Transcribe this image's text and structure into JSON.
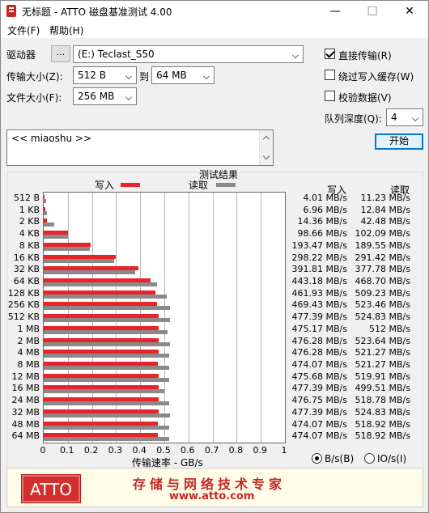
{
  "window": {
    "title": "无标题 - ATTO 磁盘基准测试 4.00",
    "minimize": "—",
    "maximize": "☐",
    "close": "✕"
  },
  "menu": {
    "file": "文件(F)",
    "help": "帮助(H)"
  },
  "drive": {
    "label": "驱动器",
    "browse": "...",
    "value": "(E:) Teclast_S50"
  },
  "transfer_size": {
    "label": "传输大小(Z):",
    "from": "512 B",
    "to_label": "到",
    "to": "64 MB"
  },
  "file_size": {
    "label": "文件大小(F):",
    "value": "256 MB"
  },
  "options": {
    "direct_io": {
      "label": "直接传输(R)",
      "checked": true
    },
    "bypass_cache": {
      "label": "绕过写入缓存(W)",
      "checked": false
    },
    "verify": {
      "label": "校验数据(V)",
      "checked": false
    },
    "queue_depth_label": "队列深度(Q):",
    "queue_depth": "4"
  },
  "description": "<< miaoshu >>",
  "start_button": "开始",
  "results": {
    "group_title": "测试结果",
    "legend_write": "写入",
    "legend_read": "读取",
    "col_write": "写入",
    "col_read": "读取",
    "colors": {
      "write": "#e8242a",
      "read": "#8a8a8a"
    }
  },
  "chart_data": {
    "type": "bar",
    "orientation": "horizontal",
    "categories": [
      "512 B",
      "1 KB",
      "2 KB",
      "4 KB",
      "8 KB",
      "16 KB",
      "32 KB",
      "64 KB",
      "128 KB",
      "256 KB",
      "512 KB",
      "1 MB",
      "2 MB",
      "4 MB",
      "8 MB",
      "12 MB",
      "16 MB",
      "24 MB",
      "32 MB",
      "48 MB",
      "64 MB"
    ],
    "series": [
      {
        "name": "写入",
        "values": [
          0.004,
          0.007,
          0.014,
          0.099,
          0.193,
          0.298,
          0.392,
          0.443,
          0.462,
          0.469,
          0.477,
          0.475,
          0.476,
          0.476,
          0.474,
          0.476,
          0.477,
          0.477,
          0.477,
          0.474,
          0.474
        ]
      },
      {
        "name": "读取",
        "values": [
          0.011,
          0.013,
          0.042,
          0.102,
          0.19,
          0.291,
          0.378,
          0.469,
          0.509,
          0.523,
          0.525,
          0.512,
          0.524,
          0.521,
          0.521,
          0.52,
          0.5,
          0.519,
          0.525,
          0.519,
          0.519
        ]
      }
    ],
    "write_labels": [
      "4.01 MB/s",
      "6.96 MB/s",
      "14.36 MB/s",
      "98.66 MB/s",
      "193.47 MB/s",
      "298.22 MB/s",
      "391.81 MB/s",
      "443.18 MB/s",
      "461.93 MB/s",
      "469.43 MB/s",
      "477.39 MB/s",
      "475.17 MB/s",
      "476.28 MB/s",
      "476.28 MB/s",
      "474.07 MB/s",
      "475.68 MB/s",
      "477.39 MB/s",
      "476.75 MB/s",
      "477.39 MB/s",
      "474.07 MB/s",
      "474.07 MB/s"
    ],
    "read_labels": [
      "11.23 MB/s",
      "12.84 MB/s",
      "42.48 MB/s",
      "102.09 MB/s",
      "189.55 MB/s",
      "291.42 MB/s",
      "377.78 MB/s",
      "468.70 MB/s",
      "509.23 MB/s",
      "523.46 MB/s",
      "524.83 MB/s",
      "512 MB/s",
      "523.64 MB/s",
      "521.27 MB/s",
      "521.27 MB/s",
      "519.91 MB/s",
      "499.51 MB/s",
      "518.78 MB/s",
      "524.83 MB/s",
      "518.92 MB/s",
      "518.92 MB/s"
    ],
    "xticks": [
      "0",
      "0.1",
      "0.2",
      "0.3",
      "0.4",
      "0.5",
      "0.6",
      "0.7",
      "0.8",
      "0.9",
      "1"
    ],
    "xlim": [
      0,
      1
    ],
    "xlabel": "传输速率 - GB/s",
    "grid": true,
    "legend_position": "top"
  },
  "units": {
    "bytes": "B/s(B)",
    "io": "IO/s(I)",
    "selected": "bytes"
  },
  "banner": {
    "logo": "ATTO",
    "slogan": "存储与网络技术专家",
    "site": "www.atto.com"
  }
}
